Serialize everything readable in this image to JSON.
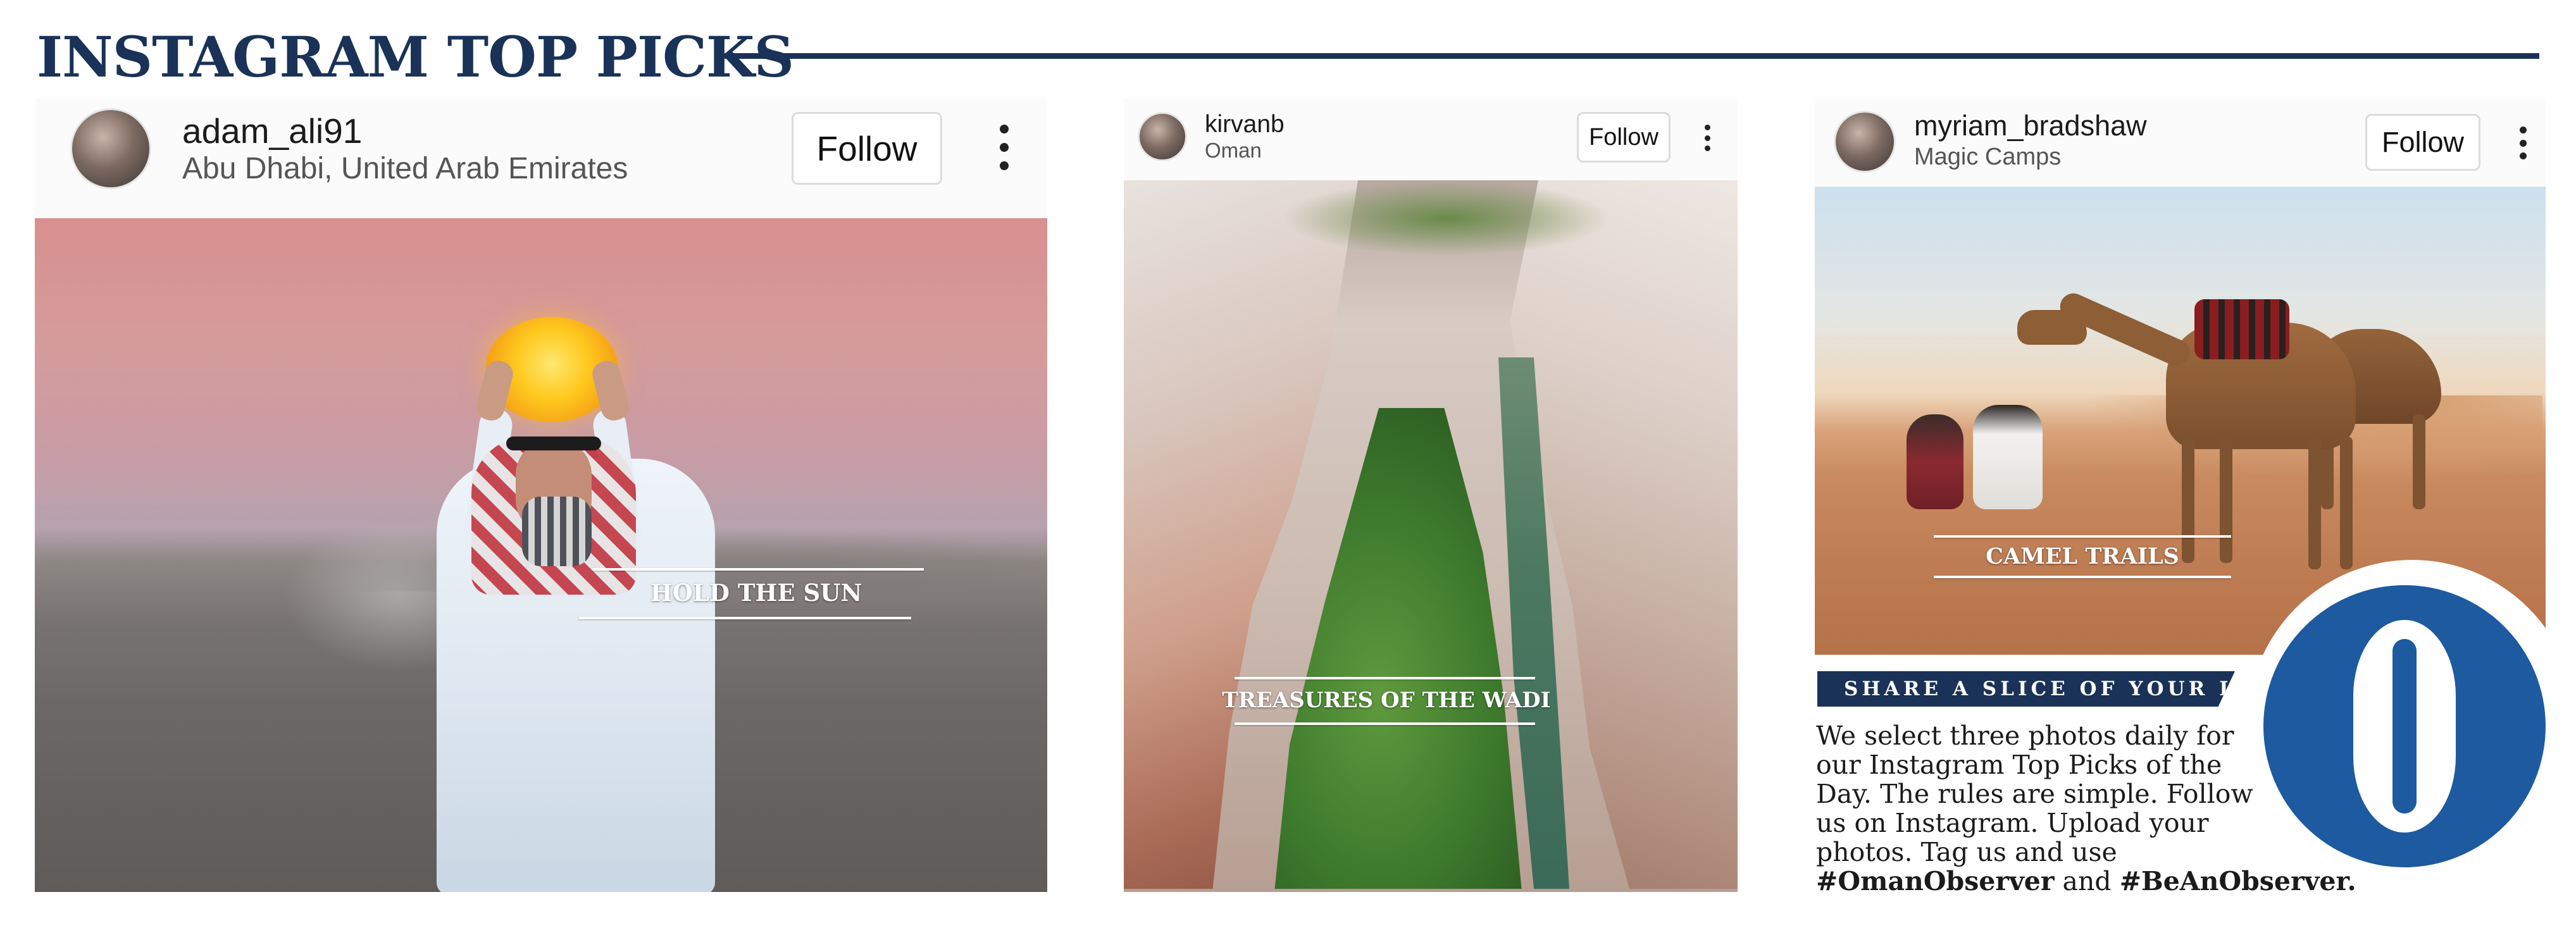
{
  "header": {
    "title": "INSTAGRAM TOP PICKS"
  },
  "posts": [
    {
      "username": "adam_ali91",
      "location": "Abu Dhabi, United Arab Emirates",
      "follow_label": "Follow",
      "more_icon": "more-vertical-icon",
      "caption": "HOLD THE SUN"
    },
    {
      "username": "kirvanb",
      "location": "Oman",
      "follow_label": "Follow",
      "more_icon": "more-vertical-icon",
      "caption": "TREASURES OF THE WADI"
    },
    {
      "username": "myriam_bradshaw",
      "location": "Magic Camps",
      "follow_label": "Follow",
      "more_icon": "more-vertical-icon",
      "caption": "CAMEL TRAILS"
    }
  ],
  "promo": {
    "tag": "SHARE A SLICE OF YOUR LIFE",
    "lines": [
      "We select three photos daily for",
      "our Instagram Top Picks of the",
      "Day. The rules are simple. Follow",
      "us on Instagram. Upload your",
      "photos. Tag us and use"
    ],
    "hashtag_1": "#OmanObserver",
    "connector": "and",
    "hashtag_2": "#BeAnObserver.",
    "logo_letter": "O"
  },
  "colors": {
    "brand_navy": "#1a3257",
    "logo_blue": "#1d5aa0"
  }
}
